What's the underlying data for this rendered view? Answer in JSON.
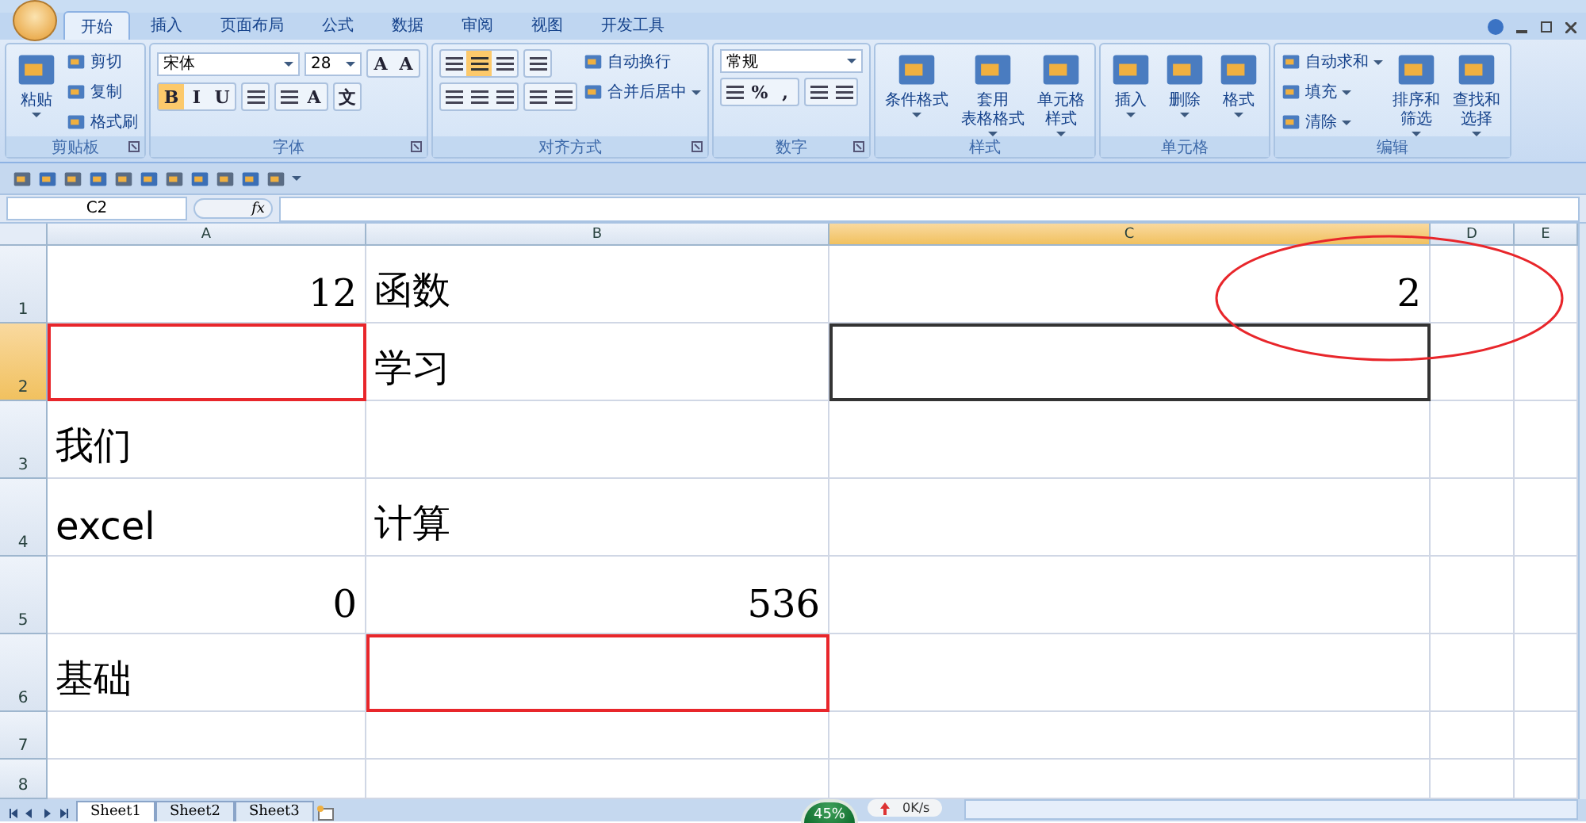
{
  "tabs": [
    {
      "label": "开始",
      "selected": true
    },
    {
      "label": "插入",
      "selected": false
    },
    {
      "label": "页面布局",
      "selected": false
    },
    {
      "label": "公式",
      "selected": false
    },
    {
      "label": "数据",
      "selected": false
    },
    {
      "label": "审阅",
      "selected": false
    },
    {
      "label": "视图",
      "selected": false
    },
    {
      "label": "开发工具",
      "selected": false
    }
  ],
  "ribbon": [
    {
      "label": "剪贴板",
      "launcher": true,
      "columns": [
        [
          [
            {
              "kind": "large",
              "lines": [
                "粘贴"
              ],
              "dropdown": true
            }
          ]
        ],
        [
          [
            {
              "kind": "small",
              "text": "剪切",
              "dropdown": false
            }
          ],
          [
            {
              "kind": "small",
              "text": "复制",
              "dropdown": false
            }
          ],
          [
            {
              "kind": "small",
              "text": "格式刷",
              "dropdown": false
            }
          ]
        ]
      ]
    },
    {
      "label": "字体",
      "launcher": true,
      "columns": [
        [
          [
            {
              "kind": "field",
              "value": "宋体",
              "wide": true
            },
            {
              "kind": "field",
              "value": "28",
              "wide": false
            },
            {
              "kind": "buttons",
              "buttons": [
                {
                  "kind": "text",
                  "text": "A",
                  "selected": false
                },
                {
                  "kind": "text",
                  "text": "A",
                  "selected": false
                }
              ]
            }
          ],
          [
            {
              "kind": "buttons",
              "buttons": [
                {
                  "kind": "text",
                  "text": "B",
                  "selected": true
                },
                {
                  "kind": "text",
                  "text": "I",
                  "selected": false
                },
                {
                  "kind": "text",
                  "text": "U",
                  "selected": false
                }
              ]
            },
            {
              "kind": "buttons",
              "buttons": [
                {
                  "kind": "icon",
                  "selected": false
                }
              ]
            },
            {
              "kind": "buttons",
              "buttons": [
                {
                  "kind": "icon",
                  "selected": false
                },
                {
                  "kind": "text",
                  "text": "A",
                  "selected": false
                }
              ]
            },
            {
              "kind": "buttons",
              "buttons": [
                {
                  "kind": "text",
                  "text": "文",
                  "selected": false
                }
              ]
            }
          ]
        ]
      ]
    },
    {
      "label": "对齐方式",
      "launcher": true,
      "columns": [
        [
          [
            {
              "kind": "buttons",
              "buttons": [
                {
                  "kind": "icon",
                  "selected": false
                },
                {
                  "kind": "icon",
                  "selected": true
                },
                {
                  "kind": "icon",
                  "selected": false
                }
              ]
            },
            {
              "kind": "buttons",
              "buttons": [
                {
                  "kind": "icon",
                  "selected": false
                }
              ]
            }
          ],
          [
            {
              "kind": "buttons",
              "buttons": [
                {
                  "kind": "icon",
                  "selected": false
                },
                {
                  "kind": "icon",
                  "selected": false
                },
                {
                  "kind": "icon",
                  "selected": false
                }
              ]
            },
            {
              "kind": "buttons",
              "buttons": [
                {
                  "kind": "icon",
                  "selected": false
                },
                {
                  "kind": "icon",
                  "selected": false
                }
              ]
            }
          ]
        ],
        [
          [
            {
              "kind": "small",
              "text": "自动换行",
              "dropdown": false
            }
          ],
          [
            {
              "kind": "small",
              "text": "合并后居中",
              "dropdown": true
            }
          ]
        ]
      ]
    },
    {
      "label": "数字",
      "launcher": true,
      "columns": [
        [
          [
            {
              "kind": "field",
              "value": "常规",
              "wide": true
            }
          ],
          [
            {
              "kind": "buttons",
              "buttons": [
                {
                  "kind": "icon",
                  "selected": false
                },
                {
                  "kind": "text",
                  "text": "%",
                  "selected": false
                },
                {
                  "kind": "text",
                  "text": ",",
                  "selected": false
                }
              ]
            },
            {
              "kind": "buttons",
              "buttons": [
                {
                  "kind": "icon",
                  "selected": false
                },
                {
                  "kind": "icon",
                  "selected": false
                }
              ]
            }
          ]
        ]
      ]
    },
    {
      "label": "样式",
      "launcher": false,
      "columns": [
        [
          [
            {
              "kind": "large",
              "lines": [
                "条件格式"
              ],
              "dropdown": true
            }
          ]
        ],
        [
          [
            {
              "kind": "large",
              "lines": [
                "套用",
                "表格格式"
              ],
              "dropdown": true
            }
          ]
        ],
        [
          [
            {
              "kind": "large",
              "lines": [
                "单元格",
                "样式"
              ],
              "dropdown": true
            }
          ]
        ]
      ]
    },
    {
      "label": "单元格",
      "launcher": false,
      "columns": [
        [
          [
            {
              "kind": "large",
              "lines": [
                "插入"
              ],
              "dropdown": true
            }
          ]
        ],
        [
          [
            {
              "kind": "large",
              "lines": [
                "删除"
              ],
              "dropdown": true
            }
          ]
        ],
        [
          [
            {
              "kind": "large",
              "lines": [
                "格式"
              ],
              "dropdown": true
            }
          ]
        ]
      ]
    },
    {
      "label": "编辑",
      "launcher": false,
      "columns": [
        [
          [
            {
              "kind": "small",
              "text": "自动求和",
              "dropdown": true
            }
          ],
          [
            {
              "kind": "small",
              "text": "填充",
              "dropdown": true
            }
          ],
          [
            {
              "kind": "small",
              "text": "清除",
              "dropdown": true
            }
          ]
        ],
        [
          [
            {
              "kind": "large",
              "lines": [
                "排序和",
                "筛选"
              ],
              "dropdown": true
            }
          ]
        ],
        [
          [
            {
              "kind": "large",
              "lines": [
                "查找和",
                "选择"
              ],
              "dropdown": true
            }
          ]
        ]
      ]
    }
  ],
  "name_box": "C2",
  "formula_label": "fx",
  "columns": [
    {
      "label": "A",
      "selected": false
    },
    {
      "label": "B",
      "selected": false
    },
    {
      "label": "C",
      "selected": true
    },
    {
      "label": "D",
      "selected": false
    },
    {
      "label": "E",
      "selected": false
    }
  ],
  "rows": [
    {
      "label": "1",
      "selected": false,
      "cells": [
        {
          "text": "12",
          "kind": "number",
          "selected": false,
          "highlighted": false
        },
        {
          "text": "函数",
          "kind": "text",
          "selected": false,
          "highlighted": false
        },
        {
          "text": "2",
          "kind": "number",
          "selected": false,
          "highlighted": false
        },
        {
          "selected": false,
          "highlighted": false
        },
        {
          "selected": false,
          "highlighted": false
        }
      ]
    },
    {
      "label": "2",
      "selected": true,
      "cells": [
        {
          "selected": false,
          "highlighted": true
        },
        {
          "text": "学习",
          "kind": "text",
          "selected": false,
          "highlighted": false
        },
        {
          "selected": true,
          "highlighted": false
        },
        {
          "selected": false,
          "highlighted": false
        },
        {
          "selected": false,
          "highlighted": false
        }
      ]
    },
    {
      "label": "3",
      "selected": false,
      "cells": [
        {
          "text": "我们",
          "kind": "text",
          "selected": false,
          "highlighted": false
        },
        {
          "selected": false,
          "highlighted": false
        },
        {
          "selected": false,
          "highlighted": false
        },
        {
          "selected": false,
          "highlighted": false
        },
        {
          "selected": false,
          "highlighted": false
        }
      ]
    },
    {
      "label": "4",
      "selected": false,
      "cells": [
        {
          "text": "excel",
          "kind": "text",
          "selected": false,
          "highlighted": false
        },
        {
          "text": "计算",
          "kind": "text",
          "selected": false,
          "highlighted": false
        },
        {
          "selected": false,
          "highlighted": false
        },
        {
          "selected": false,
          "highlighted": false
        },
        {
          "selected": false,
          "highlighted": false
        }
      ]
    },
    {
      "label": "5",
      "selected": false,
      "cells": [
        {
          "text": "0",
          "kind": "number",
          "selected": false,
          "highlighted": false
        },
        {
          "text": "536",
          "kind": "number",
          "selected": false,
          "highlighted": false
        },
        {
          "selected": false,
          "highlighted": false
        },
        {
          "selected": false,
          "highlighted": false
        },
        {
          "selected": false,
          "highlighted": false
        }
      ]
    },
    {
      "label": "6",
      "selected": false,
      "cells": [
        {
          "text": "基础",
          "kind": "text",
          "selected": false,
          "highlighted": false
        },
        {
          "selected": false,
          "highlighted": true
        },
        {
          "selected": false,
          "highlighted": false
        },
        {
          "selected": false,
          "highlighted": false
        },
        {
          "selected": false,
          "highlighted": false
        }
      ]
    },
    {
      "label": "7",
      "selected": false,
      "cells": [
        {
          "selected": false,
          "highlighted": false
        },
        {
          "selected": false,
          "highlighted": false
        },
        {
          "selected": false,
          "highlighted": false
        },
        {
          "selected": false,
          "highlighted": false
        },
        {
          "selected": false,
          "highlighted": false
        }
      ]
    },
    {
      "label": "8",
      "selected": false,
      "cells": [
        {
          "selected": false,
          "highlighted": false
        },
        {
          "selected": false,
          "highlighted": false
        },
        {
          "selected": false,
          "highlighted": false
        },
        {
          "selected": false,
          "highlighted": false
        },
        {
          "selected": false,
          "highlighted": false
        }
      ]
    }
  ],
  "annotation": {
    "kind": "ellipse",
    "color": "#e8262b"
  },
  "sheet_tabs": [
    {
      "label": "Sheet1",
      "selected": true
    },
    {
      "label": "Sheet2",
      "selected": false
    },
    {
      "label": "Sheet3",
      "selected": false
    }
  ],
  "speed_meter": {
    "percent": "45%",
    "rate": "0K/s"
  }
}
